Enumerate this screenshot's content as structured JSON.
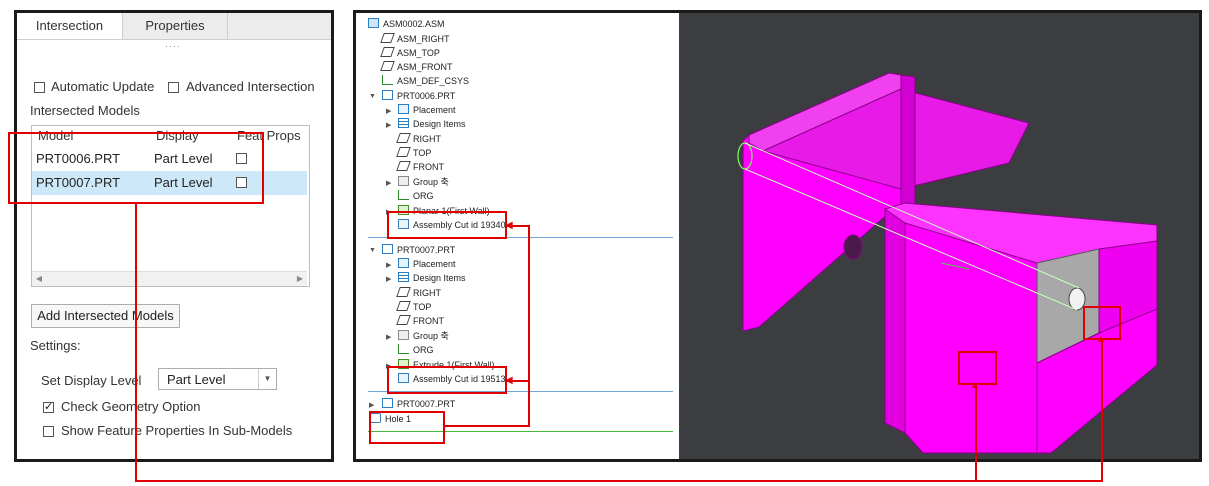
{
  "left_panel": {
    "tabs": [
      "Intersection",
      "Properties"
    ],
    "automatic_update": {
      "label": "Automatic Update",
      "checked": false
    },
    "advanced_intersection": {
      "label": "Advanced Intersection",
      "checked": false
    },
    "intersected_models_label": "Intersected Models",
    "table": {
      "headers": [
        "Model",
        "Display",
        "Feat Props"
      ],
      "rows": [
        {
          "model": "PRT0006.PRT",
          "display": "Part Level",
          "feat_props": false,
          "selected": false
        },
        {
          "model": "PRT0007.PRT",
          "display": "Part Level",
          "feat_props": false,
          "selected": true
        }
      ]
    },
    "add_button": "Add Intersected Models",
    "settings_label": "Settings:",
    "display_level_label": "Set Display Level",
    "display_level_value": "Part Level",
    "check_geometry": {
      "label": "Check Geometry Option",
      "checked": true
    },
    "show_feature_props": {
      "label": "Show Feature Properties In Sub-Models",
      "checked": false
    }
  },
  "tree": {
    "items": [
      {
        "label": "ASM0002.ASM",
        "icon": "assembly-icon"
      },
      {
        "label": "ASM_RIGHT",
        "icon": "datum-plane-icon"
      },
      {
        "label": "ASM_TOP",
        "icon": "datum-plane-icon"
      },
      {
        "label": "ASM_FRONT",
        "icon": "datum-plane-icon"
      },
      {
        "label": "ASM_DEF_CSYS",
        "icon": "csys-icon"
      },
      {
        "label": "PRT0006.PRT",
        "icon": "part-icon"
      },
      {
        "label": "Placement",
        "icon": "placement-icon"
      },
      {
        "label": "Design Items",
        "icon": "design-items-icon"
      },
      {
        "label": "RIGHT",
        "icon": "datum-plane-icon"
      },
      {
        "label": "TOP",
        "icon": "datum-plane-icon"
      },
      {
        "label": "FRONT",
        "icon": "datum-plane-icon"
      },
      {
        "label": "Group 축",
        "icon": "group-icon"
      },
      {
        "label": "ORG",
        "icon": "csys-icon"
      },
      {
        "label": "Planar 1(First Wall)",
        "icon": "sheetmetal-wall-icon"
      },
      {
        "label": "Assembly Cut id 19340",
        "icon": "assembly-cut-icon"
      },
      {
        "label": "PRT0007.PRT",
        "icon": "part-icon"
      },
      {
        "label": "Placement",
        "icon": "placement-icon"
      },
      {
        "label": "Design Items",
        "icon": "design-items-icon"
      },
      {
        "label": "RIGHT",
        "icon": "datum-plane-icon"
      },
      {
        "label": "TOP",
        "icon": "datum-plane-icon"
      },
      {
        "label": "FRONT",
        "icon": "datum-plane-icon"
      },
      {
        "label": "Group 축",
        "icon": "group-icon"
      },
      {
        "label": "ORG",
        "icon": "csys-icon"
      },
      {
        "label": "Extrude 1(First Wall)",
        "icon": "sheetmetal-wall-icon"
      },
      {
        "label": "Assembly Cut id 19513",
        "icon": "assembly-cut-icon"
      },
      {
        "label": "PRT0007.PRT",
        "icon": "part-icon"
      },
      {
        "label": "Hole 1",
        "icon": "hole-icon"
      }
    ]
  },
  "viewport": {
    "background": "#3b3d40",
    "part_color": "#ff00ff",
    "cut_face_color": "#a9a9a9"
  },
  "annotation_color": "#e00000"
}
